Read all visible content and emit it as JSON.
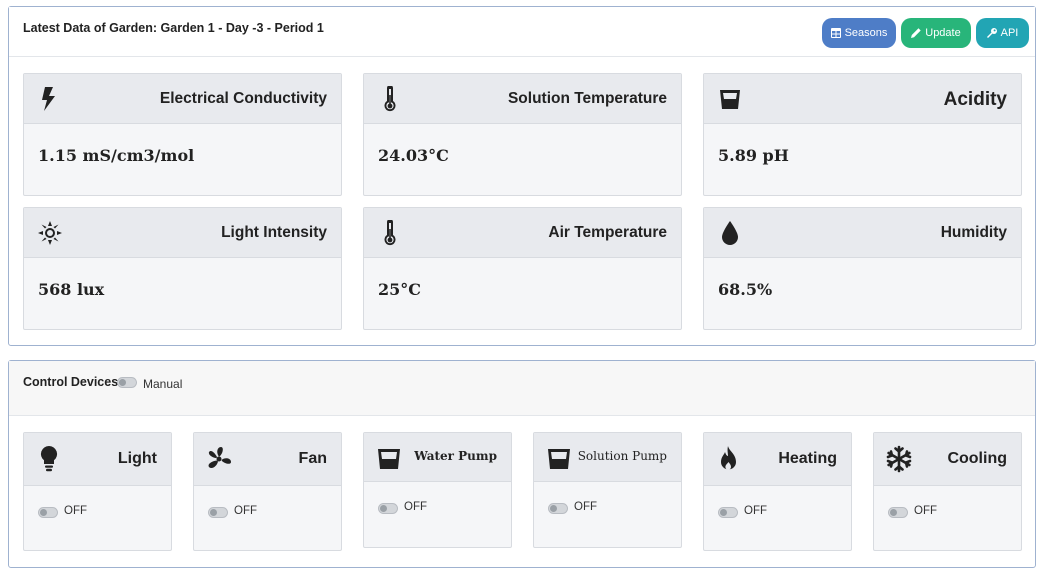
{
  "latest": {
    "title_prefix": "Latest Data of Garden: Garden",
    "garden": "1",
    "sep1": "- Day",
    "day": "-3",
    "sep2": "- Period",
    "period": "1",
    "buttons": {
      "seasons": "Seasons",
      "update": "Update",
      "api": "API"
    },
    "cards": [
      {
        "title": "Electrical Conductivity",
        "value": "1.15 mS/cm3/mol",
        "icon": "bolt-icon"
      },
      {
        "title": "Solution Temperature",
        "value": "24.03°C",
        "icon": "thermometer-icon"
      },
      {
        "title": "Acidity",
        "value": "5.89 pH",
        "icon": "beaker-icon"
      },
      {
        "title": "Light Intensity",
        "value": "568 lux",
        "icon": "sun-icon"
      },
      {
        "title": "Air Temperature",
        "value": "25°C",
        "icon": "thermometer-icon"
      },
      {
        "title": "Humidity",
        "value": "68.5%",
        "icon": "droplet-icon"
      }
    ]
  },
  "control": {
    "title": "Control Devices",
    "manual_label": "Manual",
    "devices": [
      {
        "title": "Light",
        "state": "OFF",
        "icon": "lightbulb-icon"
      },
      {
        "title": "Fan",
        "state": "OFF",
        "icon": "fan-icon"
      },
      {
        "title": "Water Pump",
        "state": "OFF",
        "icon": "beaker-icon"
      },
      {
        "title": "Solution Pump",
        "state": "OFF",
        "icon": "beaker-icon"
      },
      {
        "title": "Heating",
        "state": "OFF",
        "icon": "flame-icon"
      },
      {
        "title": "Cooling",
        "state": "OFF",
        "icon": "snowflake-icon"
      }
    ]
  },
  "colors": {
    "seasons": "#4e7dc7",
    "update": "#28b57a",
    "api": "#22a5b4",
    "panel_border": "#9fb2d0"
  }
}
